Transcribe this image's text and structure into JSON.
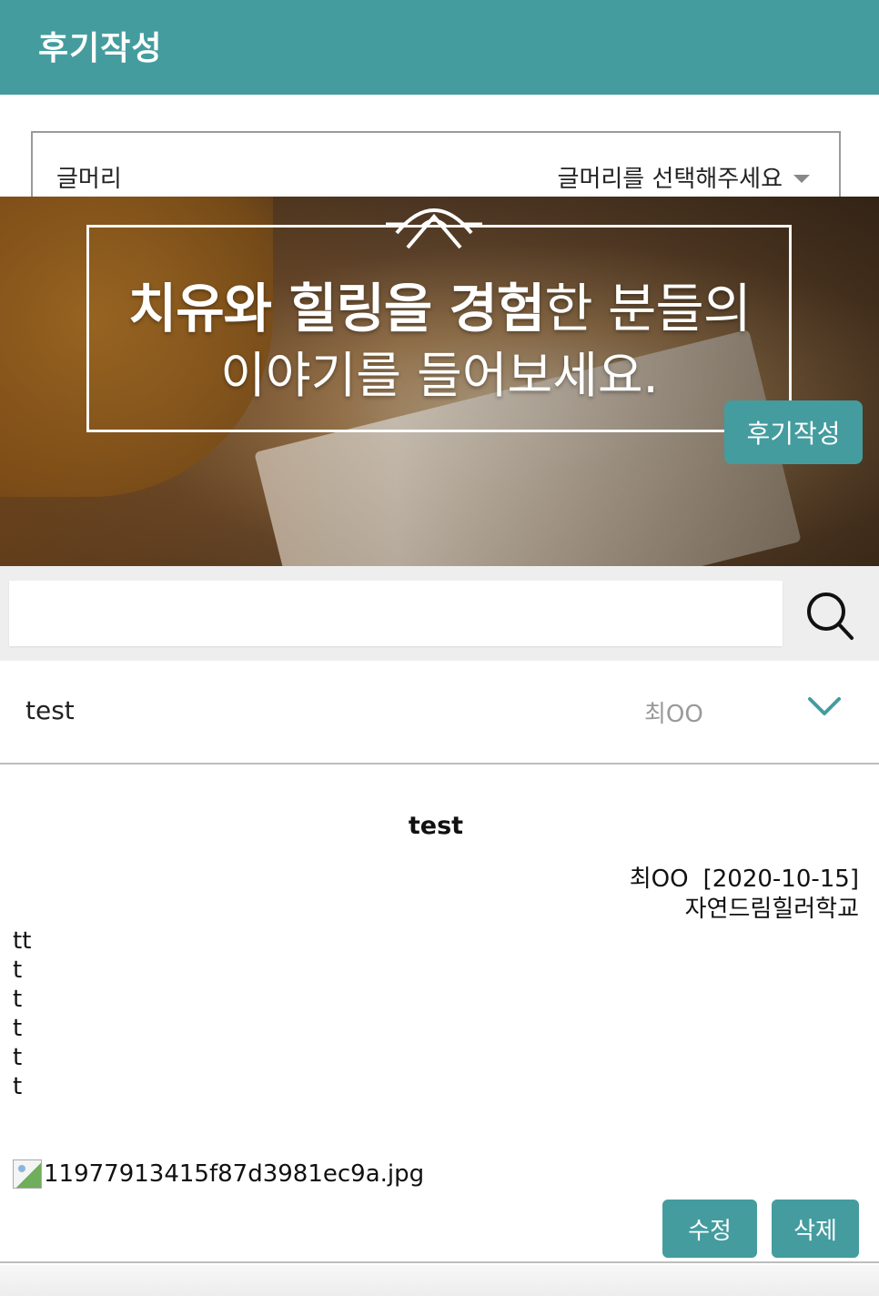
{
  "header": {
    "title": "후기작성"
  },
  "category": {
    "label": "글머리",
    "placeholder": "글머리를 선택해주세요",
    "caret_icon": "caret-down-icon"
  },
  "banner": {
    "line1_bold_a": "치유와 힐링을",
    "line1_bold_b": "경험",
    "line1_regular": "한 분들의",
    "line2": "이야기를 들어보세요.",
    "write_button": "후기작성",
    "accent": "#449c9f"
  },
  "search": {
    "value": "",
    "icon": "search-icon"
  },
  "post": {
    "title": "test",
    "author": "최OO",
    "expand_icon": "chevron-down-icon"
  },
  "detail": {
    "title": "test",
    "author": "최OO",
    "date": "[2020-10-15]",
    "organization": "자연드림힐러학교",
    "body_lines": [
      "tt",
      "t",
      "t",
      "t",
      "t",
      "t"
    ],
    "attachment_name": "11977913415f87d3981ec9a.jpg",
    "edit_button": "수정",
    "delete_button": "삭제"
  }
}
